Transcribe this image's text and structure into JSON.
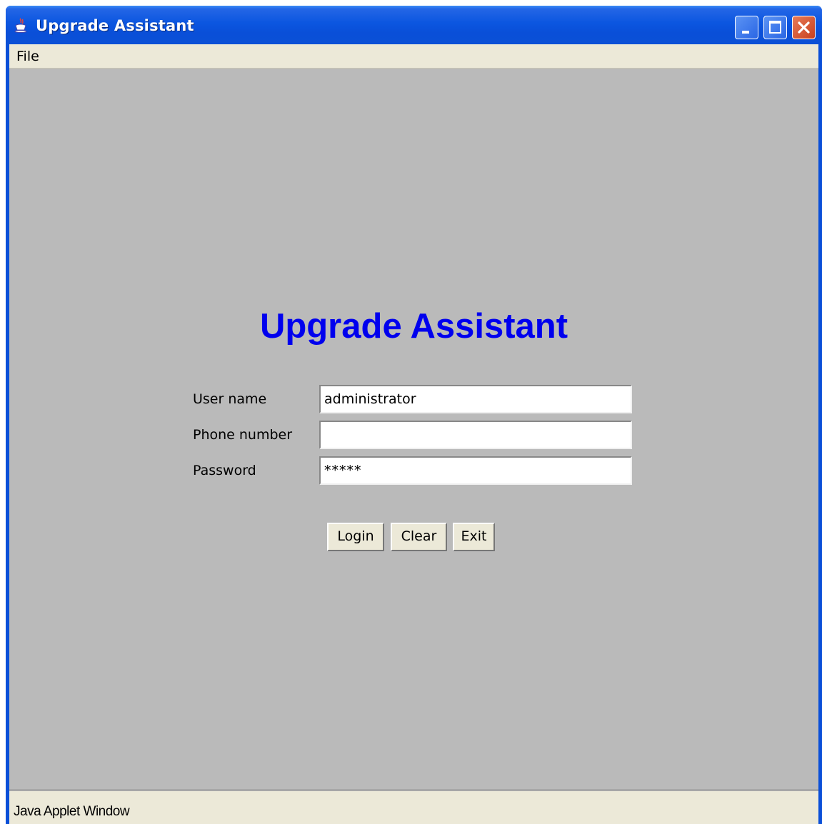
{
  "window": {
    "title": "Upgrade Assistant",
    "controls": {
      "minimize": "minimize",
      "maximize": "maximize",
      "close": "close"
    }
  },
  "menubar": {
    "items": [
      {
        "label": "File"
      }
    ]
  },
  "content": {
    "heading": "Upgrade Assistant",
    "heading_color": "#0000ee",
    "form": {
      "username": {
        "label": "User name",
        "value": "administrator"
      },
      "phone": {
        "label": "Phone number",
        "value": ""
      },
      "password": {
        "label": "Password",
        "value": "*****"
      }
    },
    "buttons": {
      "login": "Login",
      "clear": "Clear",
      "exit": "Exit"
    }
  },
  "statusbar": {
    "text": "Java Applet Window"
  },
  "icons": {
    "app": "java-cup-icon",
    "minimize": "minimize-icon",
    "maximize": "maximize-icon",
    "close": "close-icon"
  },
  "colors": {
    "titlebar": "#0a4fd8",
    "content_bg": "#bababa",
    "chrome": "#ece9d8"
  }
}
